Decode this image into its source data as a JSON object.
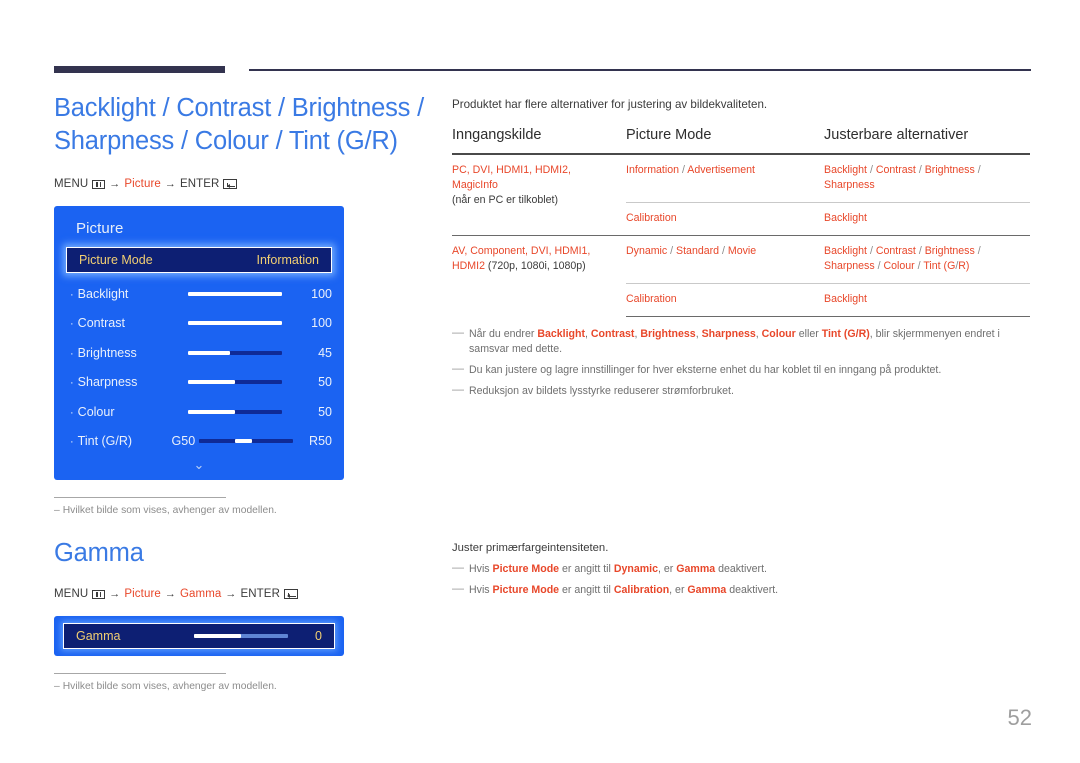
{
  "page": {
    "number": "52"
  },
  "left": {
    "section1": {
      "title": "Backlight / Contrast / Brightness / Sharpness / Colour / Tint (G/R)",
      "breadcrumb": {
        "menu_label": "MENU",
        "menu_icon": "menu-grid-icon",
        "arrow": "→",
        "step1": "Picture",
        "enter_label": "ENTER",
        "enter_icon": "enter-key-icon"
      },
      "osd": {
        "title": "Picture",
        "selected": {
          "label": "Picture Mode",
          "value": "Information"
        },
        "rows": [
          {
            "label": "Backlight",
            "value": "100",
            "fill": 100,
            "type": "bar"
          },
          {
            "label": "Contrast",
            "value": "100",
            "fill": 100,
            "type": "bar"
          },
          {
            "label": "Brightness",
            "value": "45",
            "fill": 45,
            "type": "bar"
          },
          {
            "label": "Sharpness",
            "value": "50",
            "fill": 50,
            "type": "bar"
          },
          {
            "label": "Colour",
            "value": "50",
            "fill": 50,
            "type": "bar"
          },
          {
            "label": "Tint (G/R)",
            "left_label": "G50",
            "right_label": "R50",
            "type": "centered"
          }
        ],
        "chevron": "⌄"
      },
      "footnote": "Hvilket bilde som vises, avhenger av modellen.",
      "footnote_dash": "–"
    },
    "section2": {
      "title": "Gamma",
      "breadcrumb": {
        "menu_label": "MENU",
        "arrow": "→",
        "step1": "Picture",
        "step2": "Gamma",
        "enter_label": "ENTER"
      },
      "osd": {
        "label": "Gamma",
        "value": "0",
        "fill": 50
      },
      "footnote": "Hvilket bilde som vises, avhenger av modellen.",
      "footnote_dash": "–"
    }
  },
  "right": {
    "intro": "Produktet har flere alternativer for justering av bildekvaliteten.",
    "table": {
      "headers": [
        "Inngangskilde",
        "Picture Mode",
        "Justerbare alternativer"
      ],
      "rows": [
        {
          "source_red": "PC, DVI, HDMI1, HDMI2, MagicInfo",
          "source_black": "(når en PC er tilkoblet)",
          "mode": "Information / Advertisement",
          "options": "Backlight / Contrast / Brightness / Sharpness"
        },
        {
          "source_red": "",
          "source_black": "",
          "mode": "Calibration",
          "options": "Backlight"
        },
        {
          "source_red": "AV, Component, DVI, HDMI1, HDMI2",
          "source_black": "(720p, 1080i, 1080p)",
          "mode": "Dynamic / Standard / Movie",
          "options": "Backlight / Contrast / Brightness / Sharpness / Colour / Tint (G/R)"
        },
        {
          "source_red": "",
          "source_black": "",
          "mode": "Calibration",
          "options": "Backlight"
        }
      ]
    },
    "notes": [
      "Når du endrer Backlight, Contrast, Brightness, Sharpness, Colour eller Tint (G/R), blir skjermmenyen endret i samsvar med dette.",
      "Du kan justere og lagre innstillinger for hver eksterne enhet du har koblet til en inngang på produktet.",
      "Reduksjon av bildets lysstyrke reduserer strømforbruket."
    ],
    "note_dash": "—",
    "lower": {
      "intro": "Juster primærfargeintensiteten.",
      "notes": [
        "Hvis Picture Mode er angitt til Dynamic, er Gamma deaktivert.",
        "Hvis Picture Mode er angitt til Calibration, er Gamma deaktivert."
      ]
    }
  },
  "colors": {
    "heading_blue": "#3a7ae4",
    "accent_red": "#e8472a",
    "osd_blue": "#1b63f2",
    "osd_navy": "#0d1f73",
    "osd_gold": "#f2cf72",
    "rule_navy": "#33334f"
  }
}
